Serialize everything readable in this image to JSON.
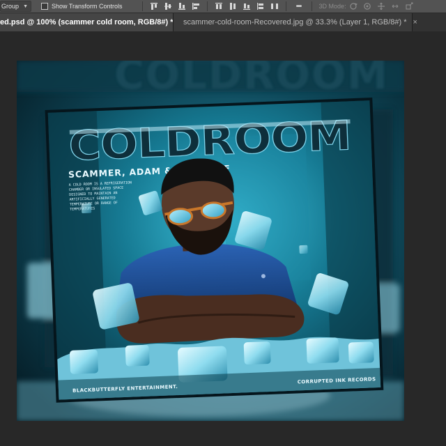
{
  "options_bar": {
    "auto_select_value": "Group",
    "show_transform_controls_label": "Show Transform Controls",
    "show_transform_controls_checked": false,
    "more_label": "•••",
    "mode_3d_label": "3D Mode:"
  },
  "tabs": [
    {
      "title": "ed.psd @ 100% (scammer cold room, RGB/8#) *",
      "close": "×",
      "active": true
    },
    {
      "title": "scammer-cold-room-Recovered.jpg @ 33.3% (Layer 1, RGB/8#) *",
      "close": "×",
      "active": false
    }
  ],
  "artwork": {
    "title": "COLDROOM",
    "background_title": "COLDROOM",
    "artists": "SCAMMER, ADAM & 031 WOLF",
    "description": [
      "A COLD ROOM IS A REFRIGERATION",
      "CHAMBER OR INSULATED SPACE",
      "DESIGNED TO MAINTAIN AN",
      "ARTIFICIALLY GENERATED",
      "TEMPERATURE OR RANGE OF",
      "TEMPERATURES"
    ],
    "credit_left": "BLACKBUTTERFLY ENTERTAINMENT.",
    "credit_right": "CORRUPTED INK RECORDS",
    "colors": {
      "ice_teal": "#2fa7c4",
      "deep_teal": "#0b3442",
      "shirt_blue": "#1f4f9a",
      "skin": "#5a3a2a",
      "lens": "#5ad0f0",
      "frame_orange": "#c9772a"
    }
  }
}
